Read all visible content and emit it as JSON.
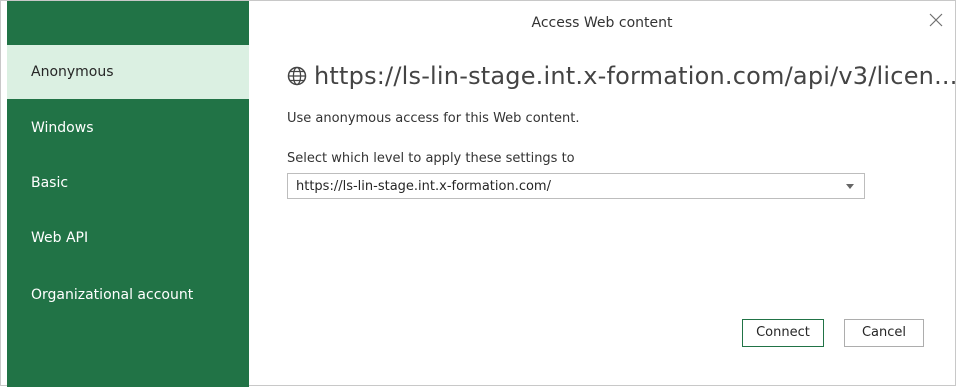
{
  "dialog": {
    "title": "Access Web content",
    "close_icon": "close-icon"
  },
  "sidebar": {
    "items": [
      {
        "label": "Anonymous",
        "selected": true
      },
      {
        "label": "Windows",
        "selected": false
      },
      {
        "label": "Basic",
        "selected": false
      },
      {
        "label": "Web API",
        "selected": false
      },
      {
        "label": "Organizational account",
        "selected": false
      }
    ]
  },
  "main": {
    "url": "https://ls-lin-stage.int.x-formation.com/api/v3/licen...",
    "url_icon": "globe-icon",
    "description": "Use anonymous access for this Web content.",
    "level_label": "Select which level to apply these settings to",
    "level_select_value": "https://ls-lin-stage.int.x-formation.com/"
  },
  "buttons": {
    "connect": "Connect",
    "cancel": "Cancel"
  },
  "colors": {
    "sidebar_bg": "#217346",
    "selected_bg": "#dbf0e2"
  }
}
